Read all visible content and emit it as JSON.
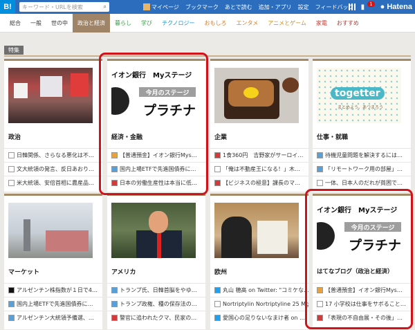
{
  "header": {
    "logo": "B!",
    "search_placeholder": "キーワード・URLを検索",
    "links": [
      "マイページ",
      "ブックマーク",
      "あとで読む",
      "追加・アプリ",
      "設定",
      "フィードバック"
    ],
    "notification_count": "1",
    "brand": "Hatena"
  },
  "categories": [
    {
      "label": "総合",
      "color": "#333333"
    },
    {
      "label": "一般",
      "color": "#333333"
    },
    {
      "label": "世の中",
      "color": "#333333"
    },
    {
      "label": "政治と経済",
      "color": "#ffffff"
    },
    {
      "label": "暮らし",
      "color": "#3a9b46"
    },
    {
      "label": "学び",
      "color": "#3a9b46"
    },
    {
      "label": "テクノロジー",
      "color": "#1d8fc6"
    },
    {
      "label": "おもしろ",
      "color": "#d97b26"
    },
    {
      "label": "エンタメ",
      "color": "#d97b26"
    },
    {
      "label": "アニメとゲーム",
      "color": "#c98a1e"
    },
    {
      "label": "家電",
      "color": "#c0342c"
    },
    {
      "label": "おすすめ",
      "color": "#c0342c"
    }
  ],
  "active_category": "政治と経済",
  "feature_label": "特集",
  "aeon_image": {
    "line1": "イオン銀行　Myステージ",
    "band": "今月のステージ",
    "big": "プラチナ"
  },
  "togetter_image": {
    "logo": "togetter",
    "tagline": "まとめよう、あつまろう"
  },
  "cards": [
    {
      "title": "政治",
      "entries": [
        {
          "icon": "page-icon",
          "text": "日韓関係、さらなる悪化は不…"
        },
        {
          "icon": "page-icon",
          "text": "文大統領の発言、反日あおり…"
        },
        {
          "icon": "page-icon",
          "text": "米大統領、安倍首相に農産品…"
        }
      ]
    },
    {
      "title": "経済・金融",
      "entries": [
        {
          "icon": "blog-icon",
          "text": "【普通預金】イオン銀行Mys…"
        },
        {
          "icon": "site-icon",
          "text": "国内上場ETFで先進国債券に…"
        },
        {
          "icon": "news-icon",
          "text": "日本の労働生産性は本当に低…"
        }
      ]
    },
    {
      "title": "企業",
      "entries": [
        {
          "icon": "news-icon",
          "text": "1食360円　吉野家がサーロイ…"
        },
        {
          "icon": "page-icon",
          "text": "「俺は不動産王になる！」木…"
        },
        {
          "icon": "news-icon",
          "text": "【ビジネスの極意】課長のマ…"
        }
      ]
    },
    {
      "title": "仕事・就職",
      "entries": [
        {
          "icon": "site-icon",
          "text": "待機児童問題を解決するには…"
        },
        {
          "icon": "site-icon",
          "text": "「リモートワーク用の部屋」…"
        },
        {
          "icon": "page-icon",
          "text": "一体、日本人のだれが貧困で…"
        }
      ]
    },
    {
      "title": "マーケット",
      "entries": [
        {
          "icon": "b-icon",
          "text": "アルゼンチン株指数が１日で4…"
        },
        {
          "icon": "site-icon",
          "text": "国内上場ETFで先進国債券に…"
        },
        {
          "icon": "site-icon",
          "text": "アルゼンチン大統領予備選、…"
        }
      ]
    },
    {
      "title": "アメリカ",
      "entries": [
        {
          "icon": "site-icon",
          "text": "トランプ氏、日韓首脳をやゆ…"
        },
        {
          "icon": "site-icon",
          "text": "トランプ政権、種の保存法の…"
        },
        {
          "icon": "news-icon",
          "text": "警官に追われたクマ、民家の…"
        }
      ]
    },
    {
      "title": "欧州",
      "entries": [
        {
          "icon": "twitter-icon",
          "text": "丸山 穂高 on Twitter: \"コミケな…"
        },
        {
          "icon": "page-icon",
          "text": "Nortriptylin Nortriptyline 25 Mg …"
        },
        {
          "icon": "twitter-icon",
          "text": "愛国心の足りないなまけ者 on …"
        }
      ]
    },
    {
      "title": "はてなブログ（政治と経済）",
      "entries": [
        {
          "icon": "blog-icon",
          "text": "【普通預金】イオン銀行Mys…"
        },
        {
          "icon": "page-icon",
          "text": "17 小学校は仕事をサボること…"
        },
        {
          "icon": "news-icon",
          "text": "「表現の不自由展・その後」…"
        }
      ]
    }
  ],
  "colors": {
    "topbar": "#2c6ebd",
    "accent": "#a08468",
    "highlight": "#d0121b"
  }
}
